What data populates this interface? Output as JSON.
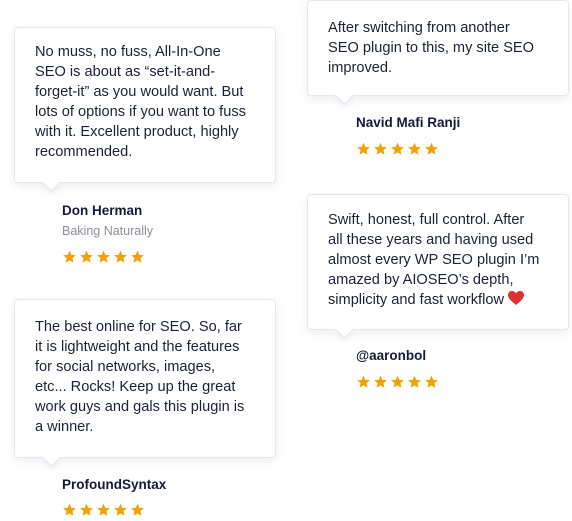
{
  "star_color": "#f1a208",
  "heart_color": "#e0302f",
  "testimonials": [
    {
      "quote": "No muss, no fuss, All-In-One\nSEO is about as “set-it-and-\nforget-it” as you would want. But\nlots of options if you want to fuss\nwith it. Excellent product, highly\nrecommended.",
      "name": "Don Herman",
      "company": "Baking Naturally",
      "rating": 5
    },
    {
      "quote": "After switching from another\nSEO plugin to this, my site SEO\nimproved.",
      "name": "Navid Mafi Ranji",
      "rating": 5
    },
    {
      "quote": "Swift, honest, full control. After\nall these years and having used\nalmost every WP SEO plugin I’m\namazed by AIOSEO’s depth,\nsimplicity and fast workflow",
      "heart_icon": "heart-icon",
      "name": "@aaronbol",
      "rating": 5
    },
    {
      "quote": "The best online for SEO. So, far\nit is lightweight and the features\nfor social networks, images,\netc... Rocks! Keep up the great\nwork guys and gals this plugin is\na winner.",
      "name": "ProfoundSyntax",
      "rating": 5
    }
  ]
}
